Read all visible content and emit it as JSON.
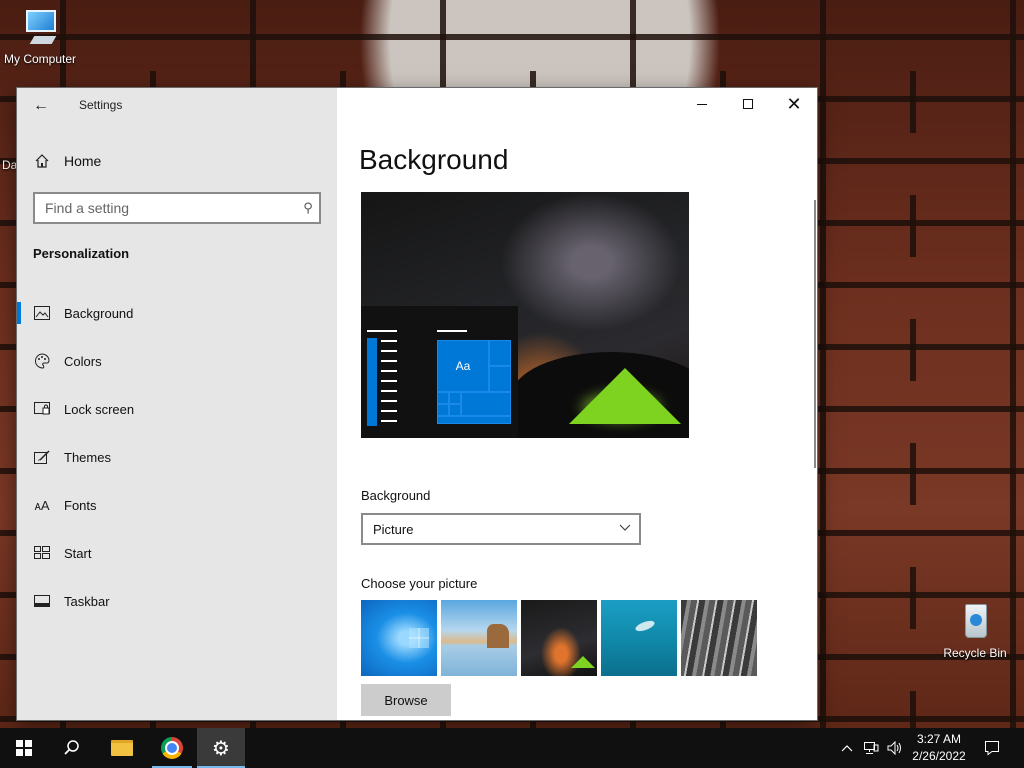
{
  "desktop": {
    "icons": [
      {
        "label": "My Computer"
      },
      {
        "label": "Recycle Bin"
      }
    ],
    "partial_label": "Da"
  },
  "window": {
    "app_title": "Settings",
    "controls": {
      "minimize": "minimize-icon",
      "maximize": "maximize-icon",
      "close": "close-icon"
    }
  },
  "sidebar": {
    "home_label": "Home",
    "search_placeholder": "Find a setting",
    "section_label": "Personalization",
    "items": [
      {
        "label": "Background",
        "icon": "picture-icon",
        "active": true
      },
      {
        "label": "Colors",
        "icon": "palette-icon"
      },
      {
        "label": "Lock screen",
        "icon": "lock-screen-icon"
      },
      {
        "label": "Themes",
        "icon": "themes-icon"
      },
      {
        "label": "Fonts",
        "icon": "fonts-icon"
      },
      {
        "label": "Start",
        "icon": "start-icon"
      },
      {
        "label": "Taskbar",
        "icon": "taskbar-icon"
      }
    ]
  },
  "main": {
    "title": "Background",
    "preview": {
      "tile_text": "Aa"
    },
    "background_field": {
      "label": "Background",
      "value": "Picture"
    },
    "choose_label": "Choose your picture",
    "browse_label": "Browse"
  },
  "taskbar": {
    "time": "3:27 AM",
    "date": "2/26/2022"
  },
  "colors": {
    "accent": "#0078d7",
    "sidebar_bg": "#e6e6e6",
    "taskbar_bg": "#101010"
  }
}
